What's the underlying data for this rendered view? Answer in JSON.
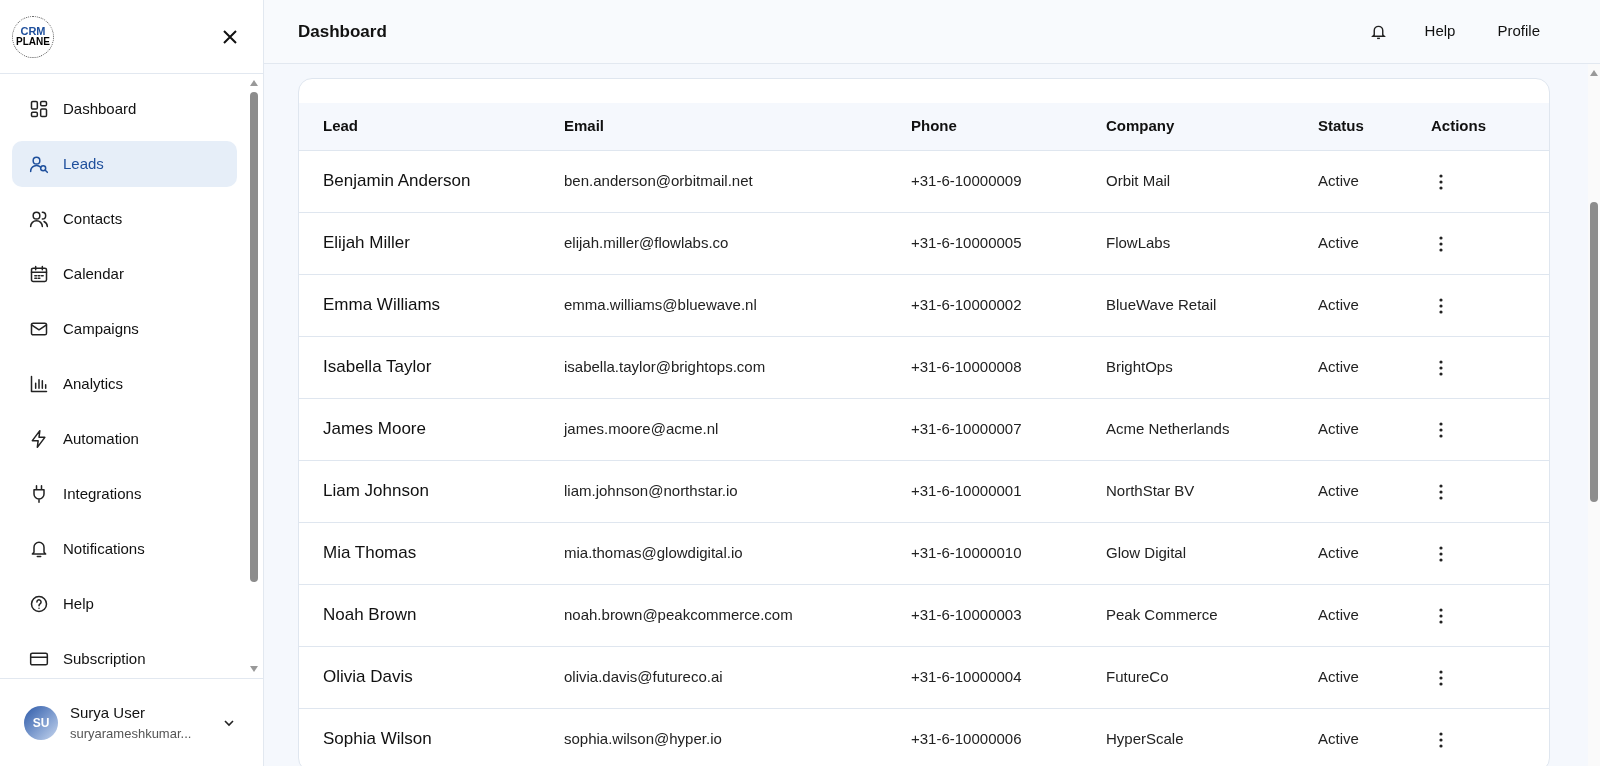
{
  "logo": {
    "line_1": "CRM",
    "line_2": "PLANE"
  },
  "sidebar": {
    "items": [
      {
        "label": "Dashboard",
        "selected": false
      },
      {
        "label": "Leads",
        "selected": true
      },
      {
        "label": "Contacts",
        "selected": false
      },
      {
        "label": "Calendar",
        "selected": false
      },
      {
        "label": "Campaigns",
        "selected": false
      },
      {
        "label": "Analytics",
        "selected": false
      },
      {
        "label": "Automation",
        "selected": false
      },
      {
        "label": "Integrations",
        "selected": false
      },
      {
        "label": "Notifications",
        "selected": false
      },
      {
        "label": "Help",
        "selected": false
      },
      {
        "label": "Subscription",
        "selected": false
      }
    ],
    "user": {
      "initials": "SU",
      "name": "Surya User",
      "email": "suryarameshkumar..."
    }
  },
  "header": {
    "title": "Dashboard",
    "links": [
      "Help",
      "Profile"
    ]
  },
  "table": {
    "columns": [
      "Lead",
      "Email",
      "Phone",
      "Company",
      "Status",
      "Actions"
    ],
    "rows": [
      [
        "Benjamin Anderson",
        "ben.anderson@orbitmail.net",
        "+31-6-10000009",
        "Orbit Mail",
        "Active"
      ],
      [
        "Elijah Miller",
        "elijah.miller@flowlabs.co",
        "+31-6-10000005",
        "FlowLabs",
        "Active"
      ],
      [
        "Emma Williams",
        "emma.williams@bluewave.nl",
        "+31-6-10000002",
        "BlueWave Retail",
        "Active"
      ],
      [
        "Isabella Taylor",
        "isabella.taylor@brightops.com",
        "+31-6-10000008",
        "BrightOps",
        "Active"
      ],
      [
        "James Moore",
        "james.moore@acme.nl",
        "+31-6-10000007",
        "Acme Netherlands",
        "Active"
      ],
      [
        "Liam Johnson",
        "liam.johnson@northstar.io",
        "+31-6-10000001",
        "NorthStar BV",
        "Active"
      ],
      [
        "Mia Thomas",
        "mia.thomas@glowdigital.io",
        "+31-6-10000010",
        "Glow Digital",
        "Active"
      ],
      [
        "Noah Brown",
        "noah.brown@peakcommerce.com",
        "+31-6-10000003",
        "Peak Commerce",
        "Active"
      ],
      [
        "Olivia Davis",
        "olivia.davis@futureco.ai",
        "+31-6-10000004",
        "FutureCo",
        "Active"
      ],
      [
        "Sophia Wilson",
        "sophia.wilson@hyper.io",
        "+31-6-10000006",
        "HyperScale",
        "Active"
      ]
    ]
  }
}
